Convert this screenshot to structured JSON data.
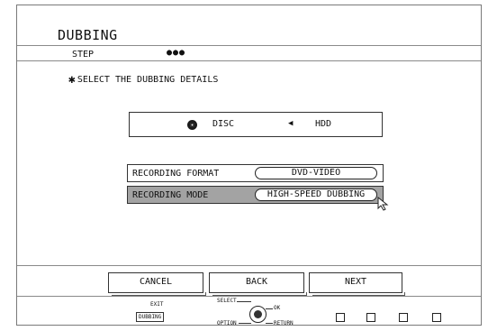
{
  "screen": {
    "title": "DUBBING",
    "step_label": "STEP",
    "step_indicator": "●●●",
    "instruction_icon": "✱",
    "instruction": "SELECT THE DUBBING DETAILS"
  },
  "source": {
    "disc_icon": "disc-icon",
    "disc_label": "DISC",
    "direction_icon": "◀",
    "hdd_label": "HDD"
  },
  "settings": [
    {
      "label": "RECORDING FORMAT",
      "value": "DVD-VIDEO",
      "selected": false
    },
    {
      "label": "RECORDING MODE",
      "value": "HIGH-SPEED DUBBING",
      "selected": true
    }
  ],
  "buttons": {
    "cancel": "CANCEL",
    "back": "BACK",
    "next": "NEXT"
  },
  "footer": {
    "exit_label": "EXIT",
    "exit_key": "DUBBING",
    "select_label": "SELECT",
    "ok_label": "OK",
    "option_label": "OPTION",
    "return_label": "RETURN",
    "color_buttons": [
      "",
      "",
      "",
      ""
    ]
  },
  "colors": {
    "highlight_row": "#a3a3a3",
    "frame_border": "#7a7a7a"
  }
}
